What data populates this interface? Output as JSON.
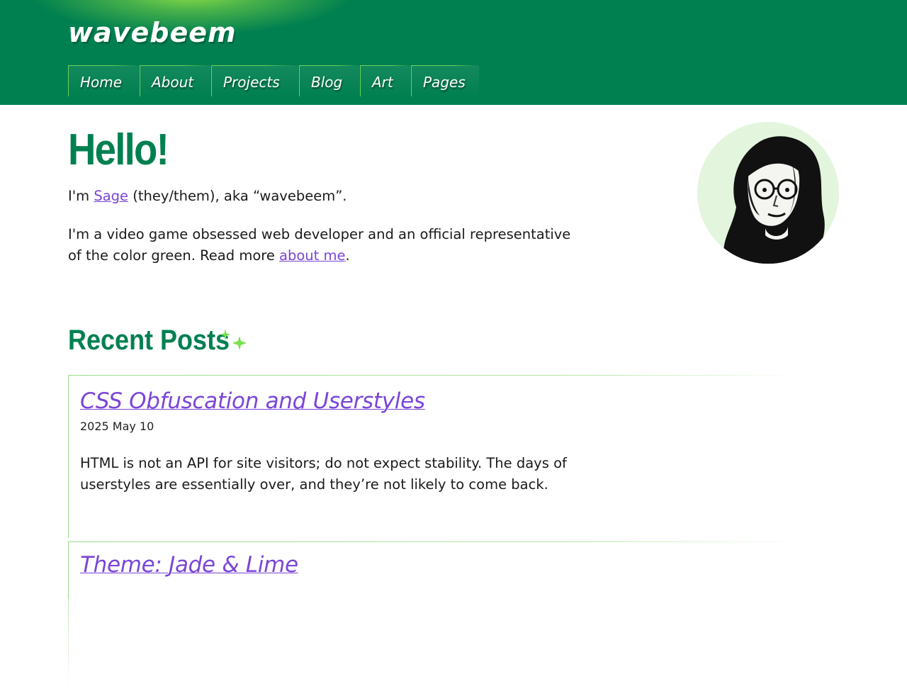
{
  "site": {
    "logo_text": "wavebeem"
  },
  "nav": {
    "items": [
      {
        "label": "Home"
      },
      {
        "label": "About"
      },
      {
        "label": "Projects"
      },
      {
        "label": "Blog"
      },
      {
        "label": "Art"
      },
      {
        "label": "Pages"
      }
    ]
  },
  "hero": {
    "heading": "Hello!",
    "line1_prefix": "I'm ",
    "name_link": "Sage",
    "line1_suffix": " (they/them), aka “wavebeem”.",
    "line2_text": "I'm a video game obsessed web developer and an official representative of the color green. Read more ",
    "about_link": "about me",
    "line2_end": "."
  },
  "recent": {
    "heading": "Recent Posts",
    "posts": [
      {
        "title": "CSS Obfuscation and Userstyles",
        "date": "2025 May 10",
        "summary": "HTML is not an API for site visitors; do not expect stability. The days of userstyles are essentially over, and they’re not likely to come back."
      },
      {
        "title": "Theme: Jade & Lime"
      }
    ]
  },
  "colors": {
    "brand_green": "#008050",
    "accent_lime": "#6fd05a",
    "link_purple": "#7a45d8"
  }
}
